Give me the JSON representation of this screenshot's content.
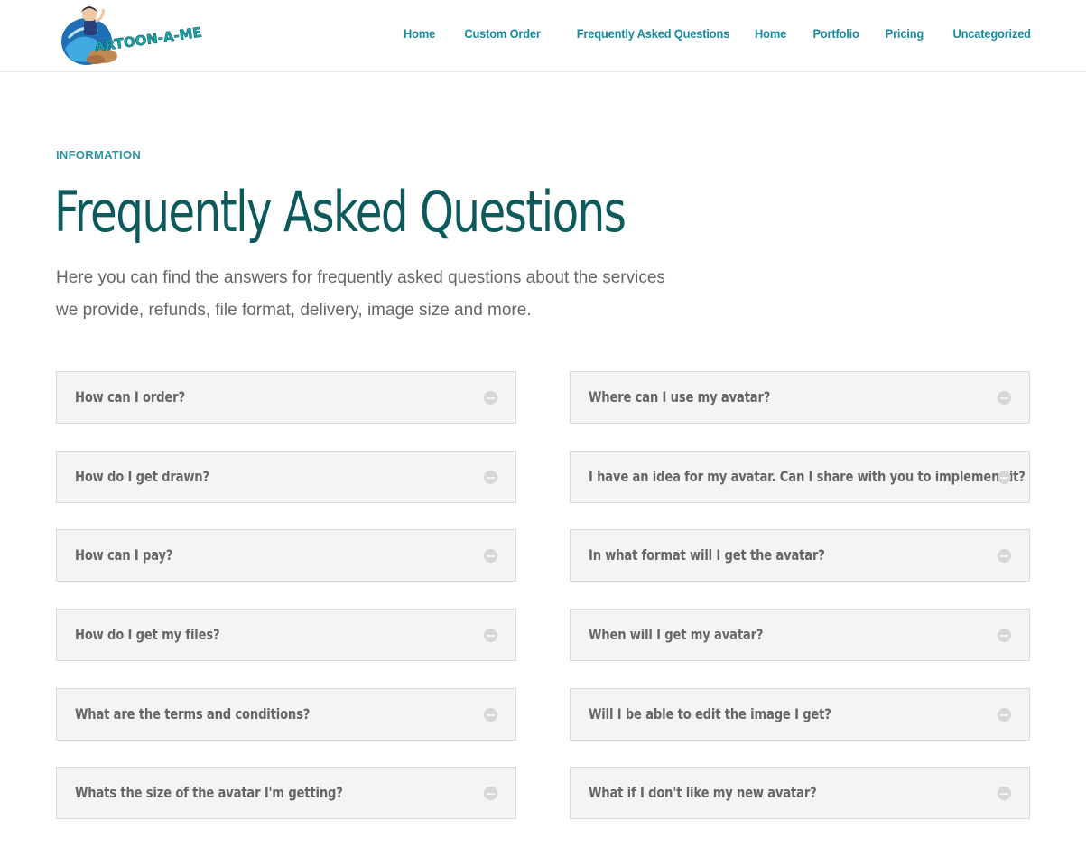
{
  "header": {
    "logo_text": "ARTOON-A-ME",
    "nav": [
      "Home",
      "Custom Order",
      "Frequently Asked Questions",
      "Home",
      "Portfolio",
      "Pricing",
      "Uncategorized"
    ]
  },
  "hero": {
    "eyebrow": "INFORMATION",
    "title": "Frequently Asked Questions",
    "subtitle_line1": "Here you can find the answers for frequently asked questions about the services",
    "subtitle_line2": "we provide, refunds, file format, delivery, image size and more."
  },
  "faq": {
    "left": [
      "How can I order?",
      "How do I get drawn?",
      "How can I pay?",
      "How do I get my files?",
      "What are the terms and conditions?",
      "Whats the size of the avatar I'm getting?"
    ],
    "right": [
      "Where can I use my avatar?",
      "I have an idea for my avatar. Can I share with you to implement it?",
      "In what format will I get the avatar?",
      "When will I get my avatar?",
      "Will I be able to edit the image I get?",
      "What if I don't like my new avatar?"
    ],
    "toggle_icon": "minus-circle-icon"
  },
  "colors": {
    "nav": "#1b8aa0",
    "title": "#0d5a5c",
    "eyebrow": "#2d95a3",
    "faq_bg": "#f4f4f4"
  }
}
